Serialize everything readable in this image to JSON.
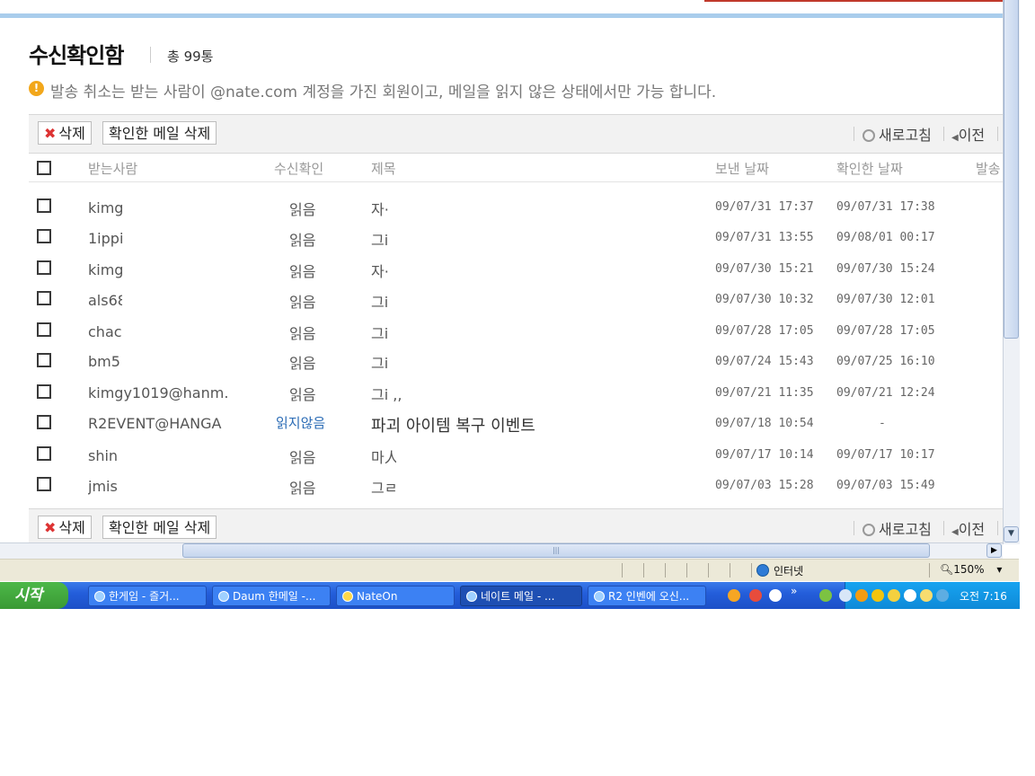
{
  "page": {
    "title": "수신확인함",
    "count": "총 99통",
    "notice": "발송 취소는 받는 사람이 @nate.com 계정을 가진 회원이고, 메일을 읽지 않은 상태에서만 가능 합니다."
  },
  "toolbar": {
    "delete_label": "삭제",
    "delete_confirmed_label": "확인한 메일 삭제",
    "refresh_label": "새로고침",
    "prev_label": "이전"
  },
  "table": {
    "columns": [
      "받는사람",
      "수신확인",
      "제목",
      "보낸 날짜",
      "확인한 날짜",
      "발송"
    ],
    "rows": [
      {
        "to": "kimg",
        "status": "읽음",
        "subject": "자·",
        "sent": "09/07/31 17:37",
        "read": "09/07/31 17:38"
      },
      {
        "to": "1ippi",
        "status": "읽음",
        "subject": "그i",
        "sent": "09/07/31 13:55",
        "read": "09/08/01 00:17"
      },
      {
        "to": "kimg",
        "status": "읽음",
        "subject": "자·",
        "sent": "09/07/30 15:21",
        "read": "09/07/30 15:24"
      },
      {
        "to": "als68",
        "status": "읽음",
        "subject": "그i",
        "sent": "09/07/30 10:32",
        "read": "09/07/30 12:01"
      },
      {
        "to": "chac",
        "status": "읽음",
        "subject": "그i",
        "sent": "09/07/28 17:05",
        "read": "09/07/28 17:05"
      },
      {
        "to": "bm5",
        "status": "읽음",
        "subject": "그i",
        "sent": "09/07/24 15:43",
        "read": "09/07/25 16:10"
      },
      {
        "to": "kimgy1019@hanm..",
        "status": "읽음",
        "subject": "그i ,,",
        "sent": "09/07/21 11:35",
        "read": "09/07/21 12:24"
      },
      {
        "to": "R2EVENT@HANGA",
        "status": "읽지않음",
        "subject": "파괴 아이템 복구 이벤트",
        "sent": "09/07/18 10:54",
        "read": "-"
      },
      {
        "to": "shin",
        "status": "읽음",
        "subject": "마人",
        "sent": "09/07/17 10:14",
        "read": "09/07/17 10:17"
      },
      {
        "to": "jmis",
        "status": "읽음",
        "subject": "그ㄹ",
        "sent": "09/07/03 15:28",
        "read": "09/07/03 15:49"
      }
    ]
  },
  "browser_status": {
    "zone": "인터넷",
    "zoom": "150%"
  },
  "taskbar": {
    "start_label": "시작",
    "tasks": [
      "한게임 - 즐거...",
      "Daum 한메일 -...",
      "NateOn",
      "네이트 메일 - ...",
      "R2 인벤에 오신..."
    ],
    "clock": "오전 7:16"
  },
  "colors": {
    "accent": "#a9cdec",
    "unread": "#2a6bb5",
    "warning": "#f2a71b",
    "taskbar": "#245edb"
  }
}
